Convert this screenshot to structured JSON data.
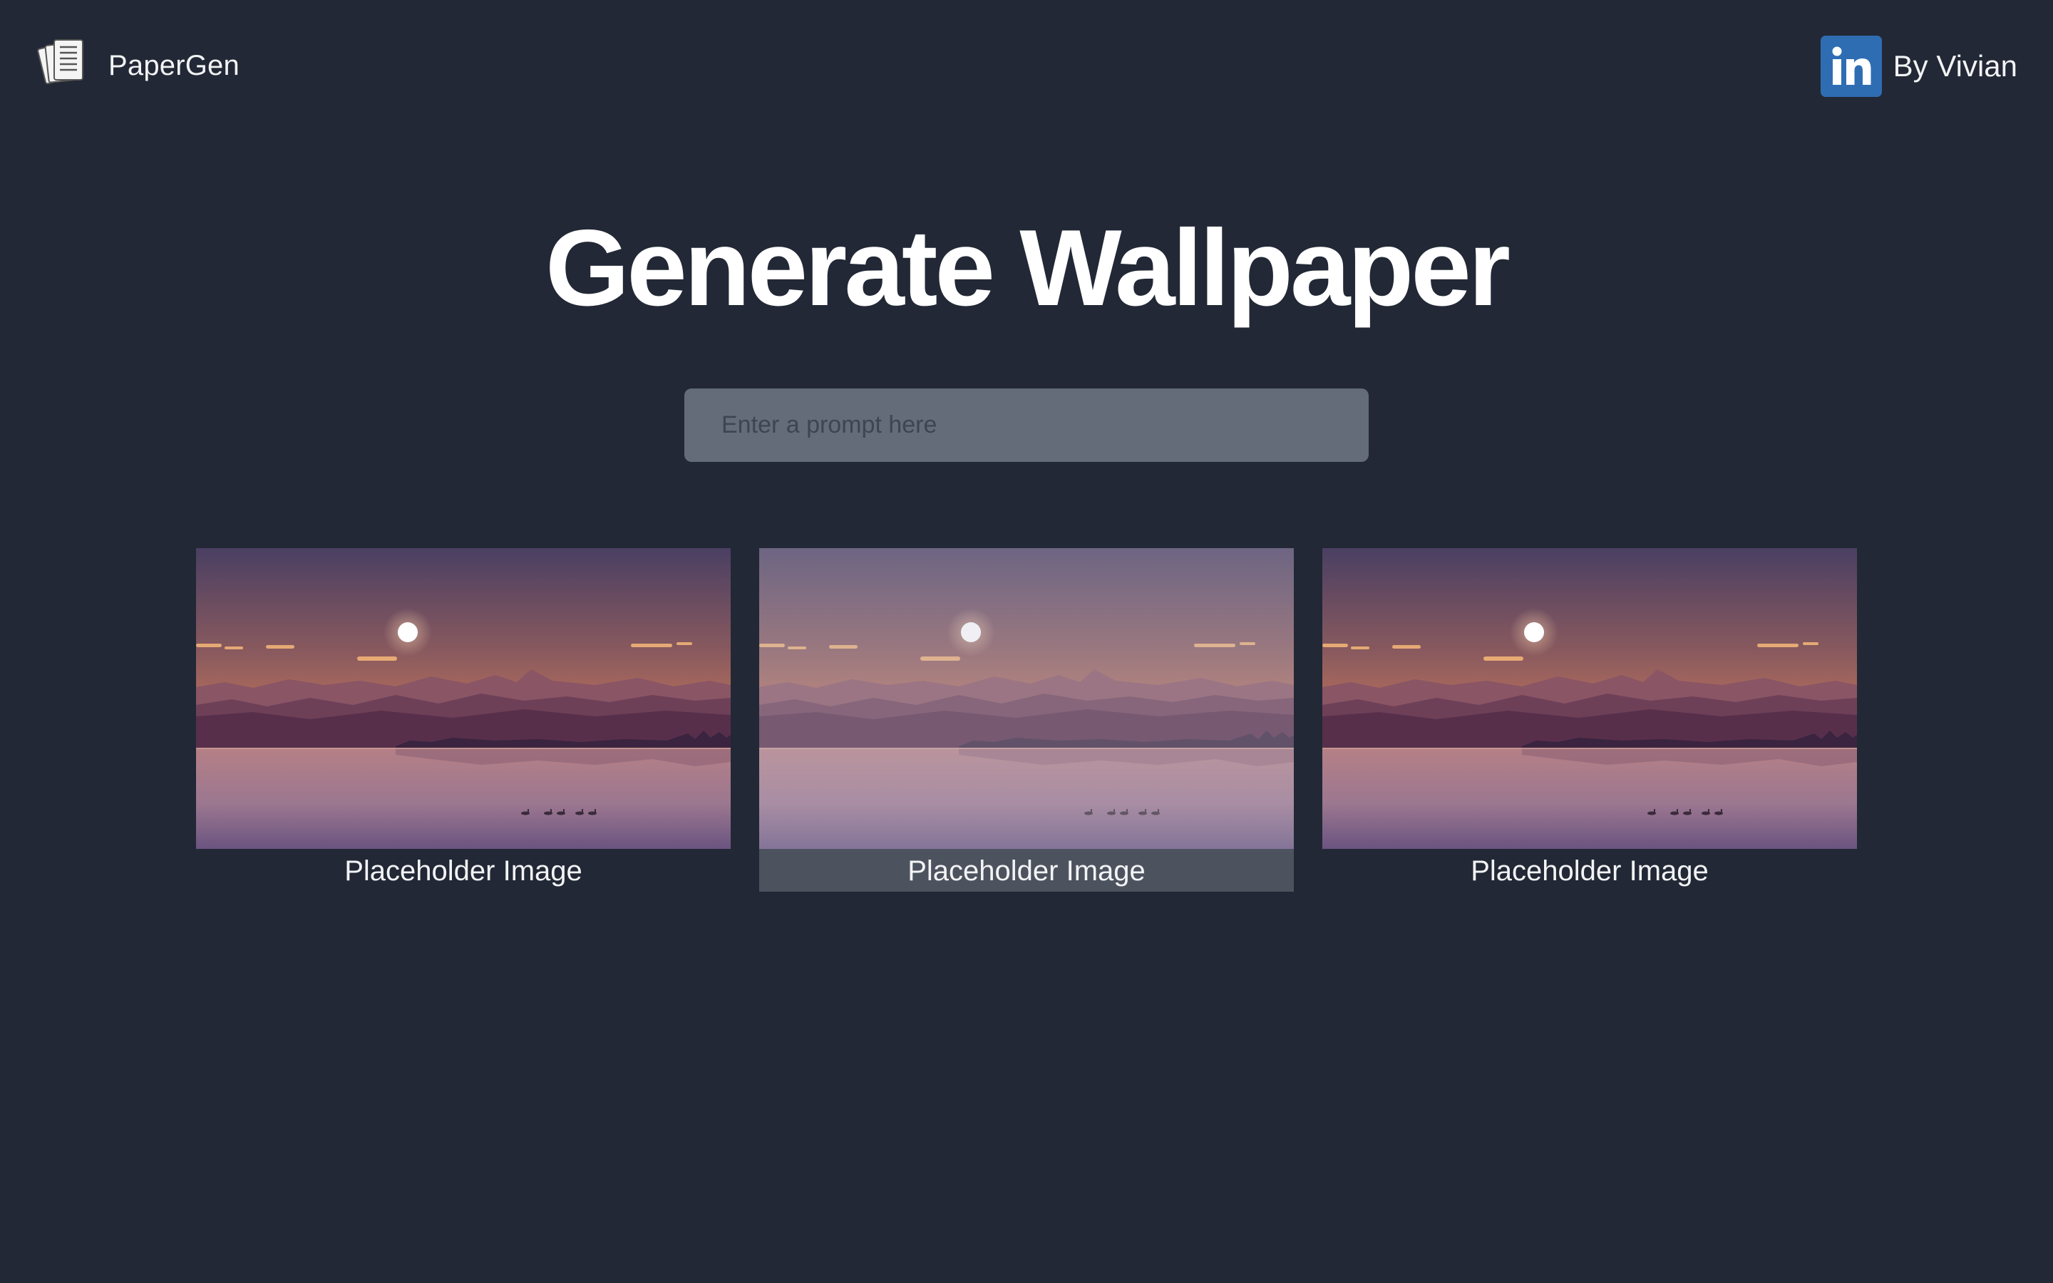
{
  "header": {
    "brand_name": "PaperGen",
    "brand_icon": "papers-stack-icon",
    "author_name": "By Vivian",
    "author_icon": "linkedin-icon",
    "linkedin_color": "#2f6db3"
  },
  "hero": {
    "title": "Generate Wallpaper"
  },
  "prompt": {
    "placeholder": "Enter a prompt here",
    "value": ""
  },
  "gallery": {
    "items": [
      {
        "caption": "Placeholder Image",
        "image_icon": "sunset-lake-wallpaper"
      },
      {
        "caption": "Placeholder Image",
        "image_icon": "sunset-lake-wallpaper"
      },
      {
        "caption": "Placeholder Image",
        "image_icon": "sunset-lake-wallpaper"
      }
    ]
  },
  "colors": {
    "background": "#222835",
    "input_background": "#636c78",
    "hover_caption_background": "#4d535e",
    "text": "#ffffff"
  }
}
